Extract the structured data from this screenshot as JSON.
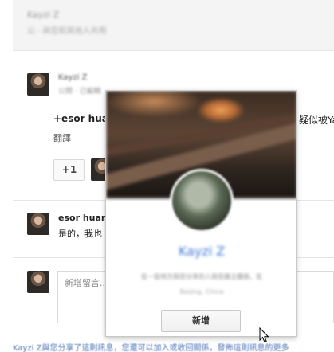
{
  "header": {
    "line1": "Kayzi Z",
    "line2": "公 · 與您和其他人共用"
  },
  "post": {
    "author": "Kayzi Z",
    "meta": "公開 · 已編輯",
    "text_bold": "+esor huan",
    "text_tail": "疑似被Yal",
    "translate_label": "翻譯",
    "plusone_label": "+1"
  },
  "comment": {
    "author": "esor huan",
    "text": "是的，我也"
  },
  "comment_box": {
    "placeholder": "新增留言..."
  },
  "hovercard": {
    "name": "Kayzi Z",
    "description": "在ㄧ些地方與您分享的人與您建立關係，在",
    "location": "Beijing, China",
    "add_label": "新增"
  },
  "footer": {
    "text": "Kayzi Z與您分享了這則訊息，您還可以加入或收回關係，發佈這則訊息的更多"
  }
}
